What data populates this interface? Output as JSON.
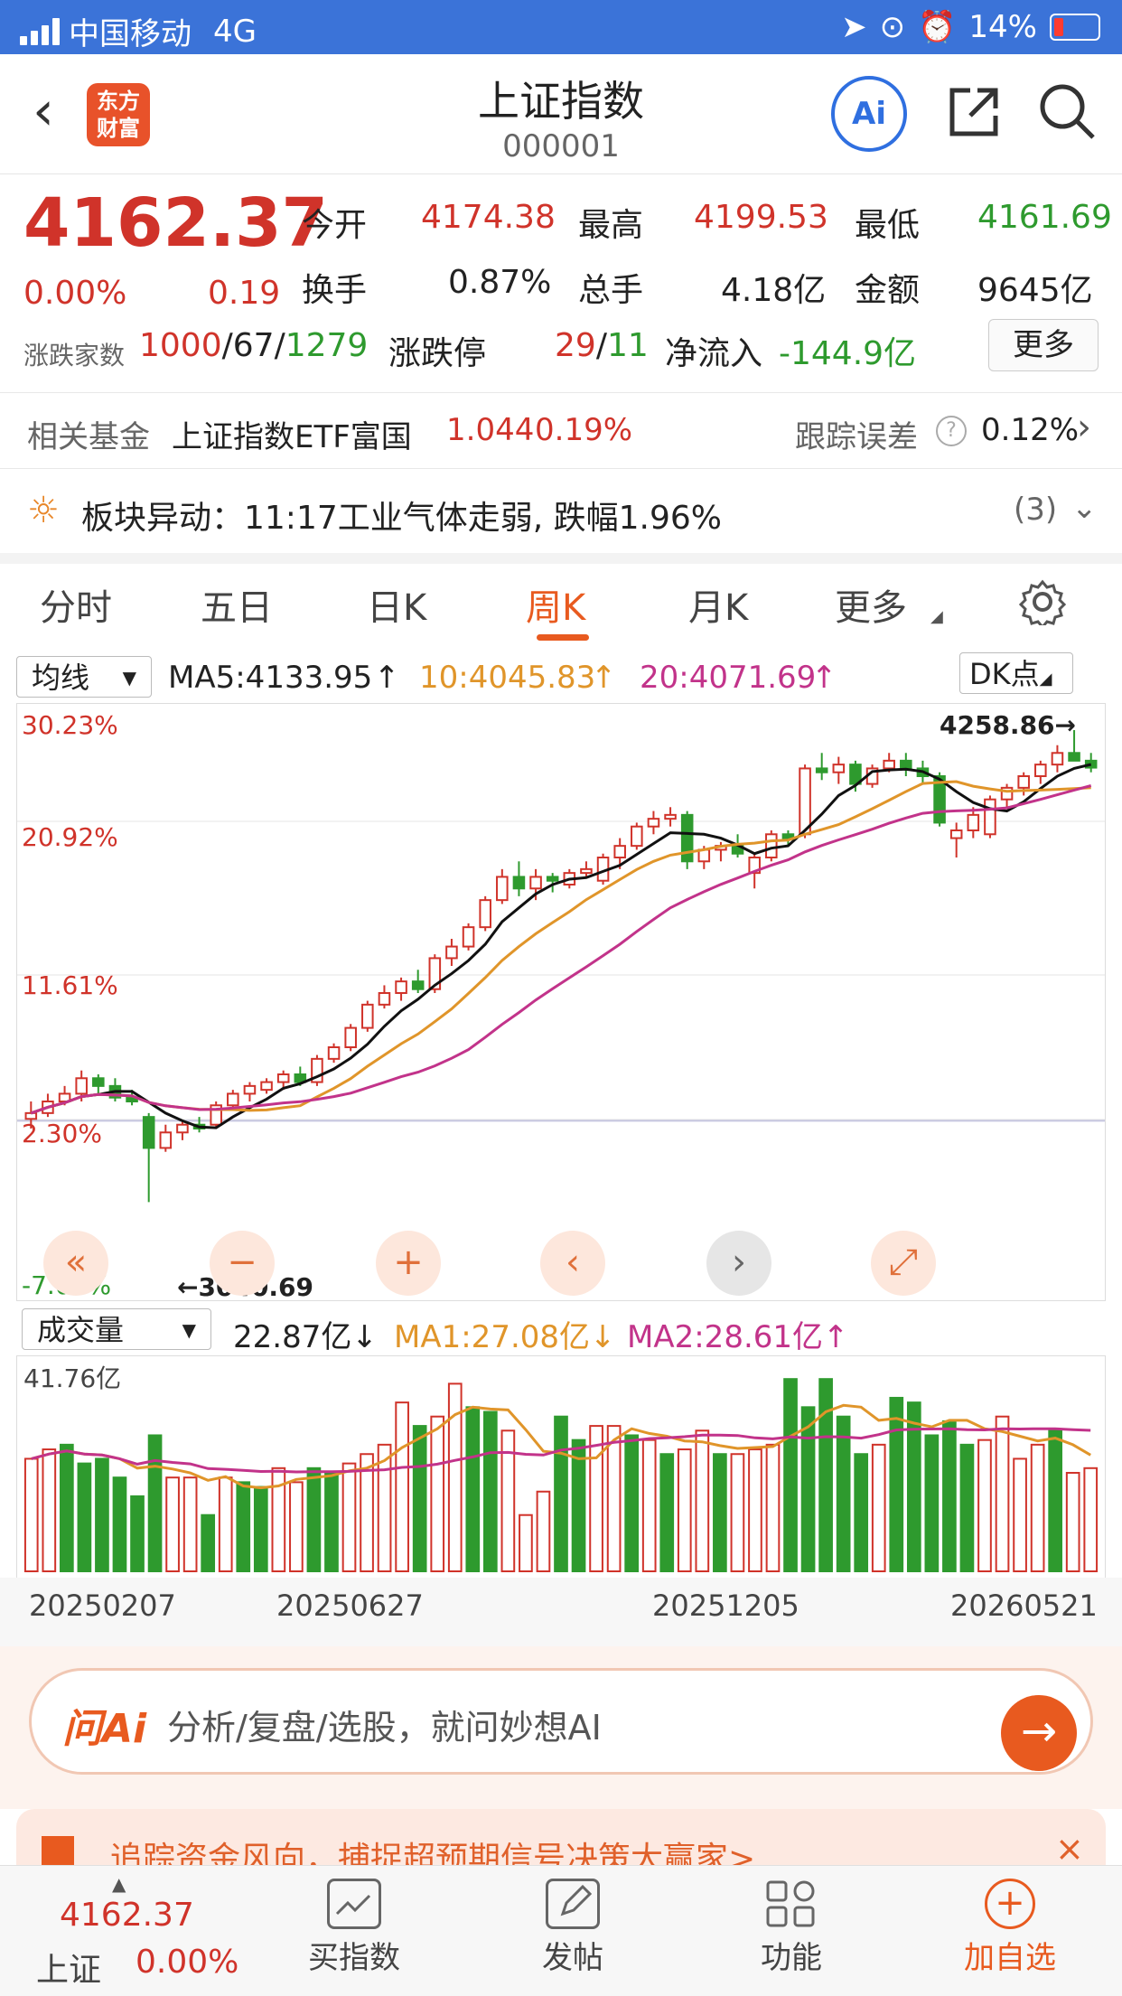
{
  "status_bar": {
    "carrier": "中国移动",
    "network": "4G",
    "battery": "14%"
  },
  "header": {
    "title": "上证指数",
    "code": "000001",
    "logo_line1": "东方",
    "logo_line2": "财富",
    "ai_label": "Ai"
  },
  "quote": {
    "price": "4162.37",
    "change_pct": "0.00%",
    "change": "0.19",
    "open_label": "今开",
    "open": "4174.38",
    "high_label": "最高",
    "high": "4199.53",
    "low_label": "最低",
    "low": "4161.69",
    "turnover_label": "换手",
    "turnover": "0.87%",
    "volume_label": "总手",
    "volume": "4.18亿",
    "amount_label": "金额",
    "amount": "9645亿",
    "adv_label": "涨跌家数",
    "adv_up": "1000",
    "adv_flat": "67",
    "adv_down": "1279",
    "limit_label": "涨跌停",
    "limit_up": "29",
    "limit_down": "11",
    "inflow_label": "净流入",
    "inflow": "-144.9亿",
    "more_label": "更多"
  },
  "fund": {
    "label": "相关基金",
    "name": "上证指数ETF富国",
    "price": "1.044",
    "pct": "0.19%",
    "track_label": "跟踪误差",
    "track_value": "0.12%"
  },
  "alert": {
    "text": "板块异动：11:17工业气体走弱, 跌幅1.96%",
    "count": "(3)"
  },
  "tabs": [
    "分时",
    "五日",
    "日K",
    "周K",
    "月K",
    "更多"
  ],
  "ma_bar": {
    "select": "均线",
    "ma5": "MA5:4133.95",
    "ma10": "10:4045.83",
    "ma20": "20:4071.69",
    "dk": "DK点"
  },
  "colors": {
    "up": "#d0332a",
    "down": "#2e9a2e",
    "ma5": "#111111",
    "ma10": "#e0952a",
    "ma20": "#c2338a",
    "accent": "#e85a1f"
  },
  "vol_bar": {
    "select": "成交量",
    "vol": "22.87亿",
    "ma1": "MA1:27.08亿",
    "ma2": "MA2:28.61亿",
    "max_label": "41.76亿"
  },
  "x_dates": [
    "20250207",
    "20250627",
    "20251205",
    "20260521"
  ],
  "chart_data": {
    "type": "candlestick",
    "y_axis_labels": [
      "30.23%",
      "20.92%",
      "11.61%",
      "2.30%",
      "-7.01%"
    ],
    "annotations": {
      "high": "4258.86",
      "low": "3040.69"
    },
    "candles": [
      {
        "o": 3255,
        "h": 3300,
        "l": 3230,
        "c": 3270
      },
      {
        "o": 3270,
        "h": 3320,
        "l": 3260,
        "c": 3300
      },
      {
        "o": 3300,
        "h": 3340,
        "l": 3290,
        "c": 3320
      },
      {
        "o": 3320,
        "h": 3380,
        "l": 3300,
        "c": 3360
      },
      {
        "o": 3360,
        "h": 3370,
        "l": 3320,
        "c": 3340
      },
      {
        "o": 3340,
        "h": 3360,
        "l": 3300,
        "c": 3310
      },
      {
        "o": 3310,
        "h": 3330,
        "l": 3290,
        "c": 3300
      },
      {
        "o": 3260,
        "h": 3270,
        "l": 3040,
        "c": 3180
      },
      {
        "o": 3180,
        "h": 3240,
        "l": 3170,
        "c": 3220
      },
      {
        "o": 3220,
        "h": 3250,
        "l": 3200,
        "c": 3240
      },
      {
        "o": 3240,
        "h": 3260,
        "l": 3220,
        "c": 3230
      },
      {
        "o": 3240,
        "h": 3300,
        "l": 3230,
        "c": 3290
      },
      {
        "o": 3290,
        "h": 3330,
        "l": 3280,
        "c": 3320
      },
      {
        "o": 3320,
        "h": 3350,
        "l": 3300,
        "c": 3340
      },
      {
        "o": 3330,
        "h": 3360,
        "l": 3320,
        "c": 3350
      },
      {
        "o": 3350,
        "h": 3380,
        "l": 3330,
        "c": 3370
      },
      {
        "o": 3370,
        "h": 3390,
        "l": 3340,
        "c": 3350
      },
      {
        "o": 3350,
        "h": 3420,
        "l": 3340,
        "c": 3410
      },
      {
        "o": 3410,
        "h": 3450,
        "l": 3400,
        "c": 3440
      },
      {
        "o": 3440,
        "h": 3500,
        "l": 3430,
        "c": 3490
      },
      {
        "o": 3490,
        "h": 3560,
        "l": 3480,
        "c": 3550
      },
      {
        "o": 3550,
        "h": 3600,
        "l": 3540,
        "c": 3580
      },
      {
        "o": 3580,
        "h": 3620,
        "l": 3560,
        "c": 3610
      },
      {
        "o": 3610,
        "h": 3640,
        "l": 3580,
        "c": 3590
      },
      {
        "o": 3590,
        "h": 3680,
        "l": 3580,
        "c": 3670
      },
      {
        "o": 3670,
        "h": 3720,
        "l": 3650,
        "c": 3700
      },
      {
        "o": 3700,
        "h": 3760,
        "l": 3690,
        "c": 3750
      },
      {
        "o": 3750,
        "h": 3830,
        "l": 3740,
        "c": 3820
      },
      {
        "o": 3820,
        "h": 3900,
        "l": 3810,
        "c": 3880
      },
      {
        "o": 3880,
        "h": 3920,
        "l": 3830,
        "c": 3850
      },
      {
        "o": 3850,
        "h": 3900,
        "l": 3820,
        "c": 3880
      },
      {
        "o": 3880,
        "h": 3890,
        "l": 3840,
        "c": 3870
      },
      {
        "o": 3860,
        "h": 3900,
        "l": 3850,
        "c": 3890
      },
      {
        "o": 3890,
        "h": 3920,
        "l": 3880,
        "c": 3900
      },
      {
        "o": 3870,
        "h": 3940,
        "l": 3860,
        "c": 3930
      },
      {
        "o": 3930,
        "h": 3980,
        "l": 3900,
        "c": 3960
      },
      {
        "o": 3960,
        "h": 4020,
        "l": 3950,
        "c": 4010
      },
      {
        "o": 4010,
        "h": 4050,
        "l": 3990,
        "c": 4030
      },
      {
        "o": 4030,
        "h": 4060,
        "l": 4010,
        "c": 4040
      },
      {
        "o": 4040,
        "h": 4050,
        "l": 3900,
        "c": 3920
      },
      {
        "o": 3920,
        "h": 3960,
        "l": 3900,
        "c": 3950
      },
      {
        "o": 3950,
        "h": 3970,
        "l": 3920,
        "c": 3960
      },
      {
        "o": 3960,
        "h": 3990,
        "l": 3930,
        "c": 3940
      },
      {
        "o": 3890,
        "h": 3940,
        "l": 3850,
        "c": 3930
      },
      {
        "o": 3930,
        "h": 4000,
        "l": 3920,
        "c": 3990
      },
      {
        "o": 3990,
        "h": 4000,
        "l": 3960,
        "c": 3980
      },
      {
        "o": 3990,
        "h": 4170,
        "l": 3980,
        "c": 4160
      },
      {
        "o": 4160,
        "h": 4200,
        "l": 4130,
        "c": 4150
      },
      {
        "o": 4150,
        "h": 4190,
        "l": 4120,
        "c": 4170
      },
      {
        "o": 4170,
        "h": 4180,
        "l": 4100,
        "c": 4120
      },
      {
        "o": 4120,
        "h": 4170,
        "l": 4110,
        "c": 4160
      },
      {
        "o": 4160,
        "h": 4200,
        "l": 4150,
        "c": 4180
      },
      {
        "o": 4180,
        "h": 4200,
        "l": 4140,
        "c": 4160
      },
      {
        "o": 4160,
        "h": 4180,
        "l": 4120,
        "c": 4140
      },
      {
        "o": 4140,
        "h": 4150,
        "l": 4010,
        "c": 4020
      },
      {
        "o": 3980,
        "h": 4020,
        "l": 3930,
        "c": 4000
      },
      {
        "o": 4000,
        "h": 4060,
        "l": 3980,
        "c": 4040
      },
      {
        "o": 3990,
        "h": 4090,
        "l": 3980,
        "c": 4080
      },
      {
        "o": 4080,
        "h": 4120,
        "l": 4060,
        "c": 4110
      },
      {
        "o": 4110,
        "h": 4150,
        "l": 4090,
        "c": 4140
      },
      {
        "o": 4140,
        "h": 4180,
        "l": 4120,
        "c": 4170
      },
      {
        "o": 4170,
        "h": 4220,
        "l": 4150,
        "c": 4200
      },
      {
        "o": 4200,
        "h": 4259,
        "l": 4180,
        "c": 4180
      },
      {
        "o": 4180,
        "h": 4200,
        "l": 4150,
        "c": 4162
      }
    ],
    "volumes": [
      {
        "v": 24,
        "d": "u"
      },
      {
        "v": 26,
        "d": "u"
      },
      {
        "v": 27,
        "d": "d"
      },
      {
        "v": 23,
        "d": "d"
      },
      {
        "v": 24,
        "d": "d"
      },
      {
        "v": 20,
        "d": "d"
      },
      {
        "v": 16,
        "d": "d"
      },
      {
        "v": 29,
        "d": "d"
      },
      {
        "v": 20,
        "d": "u"
      },
      {
        "v": 20,
        "d": "u"
      },
      {
        "v": 12,
        "d": "d"
      },
      {
        "v": 20,
        "d": "u"
      },
      {
        "v": 19,
        "d": "d"
      },
      {
        "v": 18,
        "d": "d"
      },
      {
        "v": 22,
        "d": "u"
      },
      {
        "v": 19,
        "d": "u"
      },
      {
        "v": 22,
        "d": "d"
      },
      {
        "v": 21,
        "d": "d"
      },
      {
        "v": 23,
        "d": "u"
      },
      {
        "v": 25,
        "d": "u"
      },
      {
        "v": 27,
        "d": "u"
      },
      {
        "v": 36,
        "d": "u"
      },
      {
        "v": 31,
        "d": "d"
      },
      {
        "v": 33,
        "d": "u"
      },
      {
        "v": 40,
        "d": "u"
      },
      {
        "v": 35,
        "d": "d"
      },
      {
        "v": 34,
        "d": "d"
      },
      {
        "v": 30,
        "d": "u"
      },
      {
        "v": 12,
        "d": "u"
      },
      {
        "v": 17,
        "d": "u"
      },
      {
        "v": 33,
        "d": "d"
      },
      {
        "v": 28,
        "d": "d"
      },
      {
        "v": 31,
        "d": "u"
      },
      {
        "v": 31,
        "d": "u"
      },
      {
        "v": 29,
        "d": "d"
      },
      {
        "v": 28,
        "d": "u"
      },
      {
        "v": 25,
        "d": "d"
      },
      {
        "v": 26,
        "d": "u"
      },
      {
        "v": 30,
        "d": "u"
      },
      {
        "v": 25,
        "d": "d"
      },
      {
        "v": 25,
        "d": "u"
      },
      {
        "v": 26,
        "d": "u"
      },
      {
        "v": 27,
        "d": "u"
      },
      {
        "v": 41,
        "d": "d"
      },
      {
        "v": 35,
        "d": "d"
      },
      {
        "v": 41,
        "d": "d"
      },
      {
        "v": 33,
        "d": "d"
      },
      {
        "v": 25,
        "d": "d"
      },
      {
        "v": 27,
        "d": "u"
      },
      {
        "v": 37,
        "d": "d"
      },
      {
        "v": 36,
        "d": "d"
      },
      {
        "v": 29,
        "d": "d"
      },
      {
        "v": 32,
        "d": "d"
      },
      {
        "v": 27,
        "d": "d"
      },
      {
        "v": 28,
        "d": "u"
      },
      {
        "v": 33,
        "d": "u"
      },
      {
        "v": 24,
        "d": "u"
      },
      {
        "v": 27,
        "d": "u"
      },
      {
        "v": 30,
        "d": "d"
      },
      {
        "v": 21,
        "d": "u"
      },
      {
        "v": 22,
        "d": "u"
      }
    ]
  },
  "ask_ai": {
    "brand": "问Ai",
    "placeholder": "分析/复盘/选股，就问妙想AI"
  },
  "banner": {
    "text": "追踪资金风向，捕捉超预期信号决策大赢家>"
  },
  "bottom_nav": {
    "price": "4162.37",
    "name": "上证",
    "pct": "0.00%",
    "items": [
      "买指数",
      "发帖",
      "功能",
      "加自选"
    ]
  }
}
